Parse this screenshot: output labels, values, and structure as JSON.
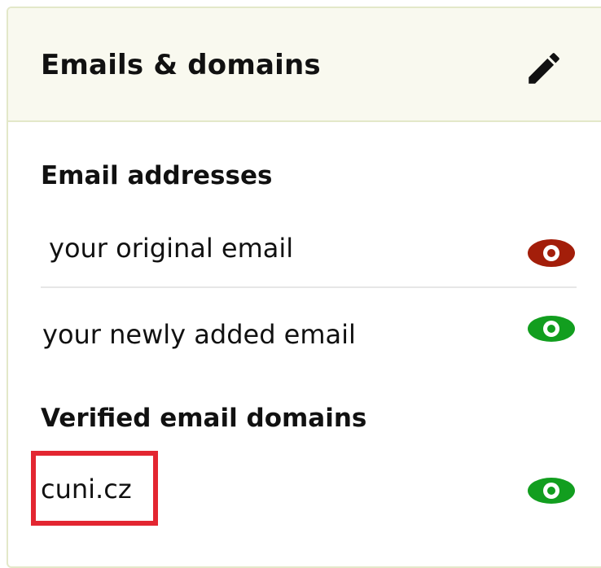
{
  "card": {
    "title": "Emails & domains",
    "edit_icon": "pencil-icon"
  },
  "email_addresses": {
    "heading": "Email addresses",
    "items": [
      {
        "label": "your original email",
        "visibility_icon": "eye-icon",
        "visibility_color": "#a31e0a"
      },
      {
        "label": "your newly added email",
        "visibility_icon": "eye-icon",
        "visibility_color": "#129e1f"
      }
    ]
  },
  "verified_domains": {
    "heading": "Verified email domains",
    "items": [
      {
        "label": "cuni.cz",
        "visibility_icon": "eye-icon",
        "visibility_color": "#129e1f",
        "highlighted": true
      }
    ]
  },
  "colors": {
    "header_bg": "#f9f9ef",
    "border": "#e3e8c9",
    "highlight": "#e32631"
  }
}
